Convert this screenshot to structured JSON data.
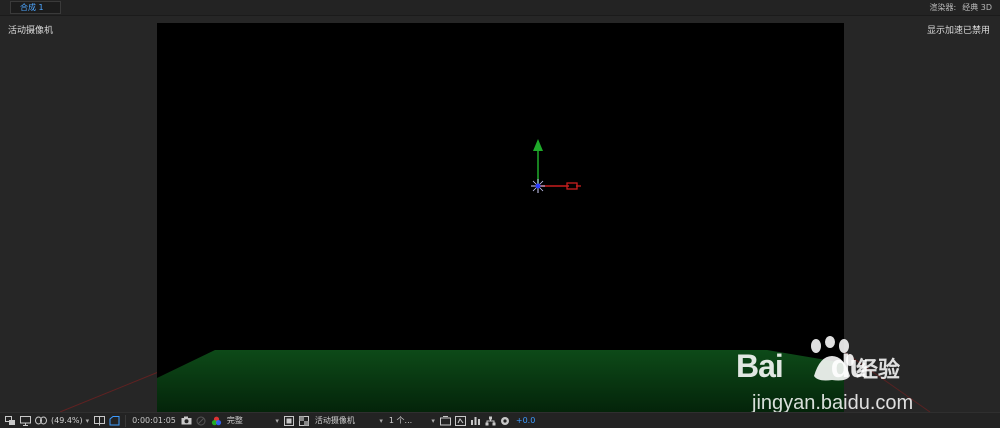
{
  "tabs": [
    {
      "label": "合成 1",
      "active": true
    }
  ],
  "renderer": {
    "label": "渲染器:",
    "value": "经典 3D"
  },
  "viewer": {
    "camera_label": "活动摄像机",
    "acceleration_label": "显示加速已禁用"
  },
  "toolbar": {
    "zoom": "(49.4%)",
    "timecode": "0:00:01:05",
    "resolution": "完整",
    "view": "活动摄像机",
    "views_count": "1 个...",
    "exposure": "+0.0"
  },
  "watermark": {
    "brand": "Bai",
    "brand_du": "du",
    "product": "经验",
    "url": "jingyan.baidu.com"
  },
  "colors": {
    "accent": "#3e9cff",
    "axis_x": "#d02020",
    "axis_y": "#20b020",
    "floor": "#0a3a12"
  }
}
